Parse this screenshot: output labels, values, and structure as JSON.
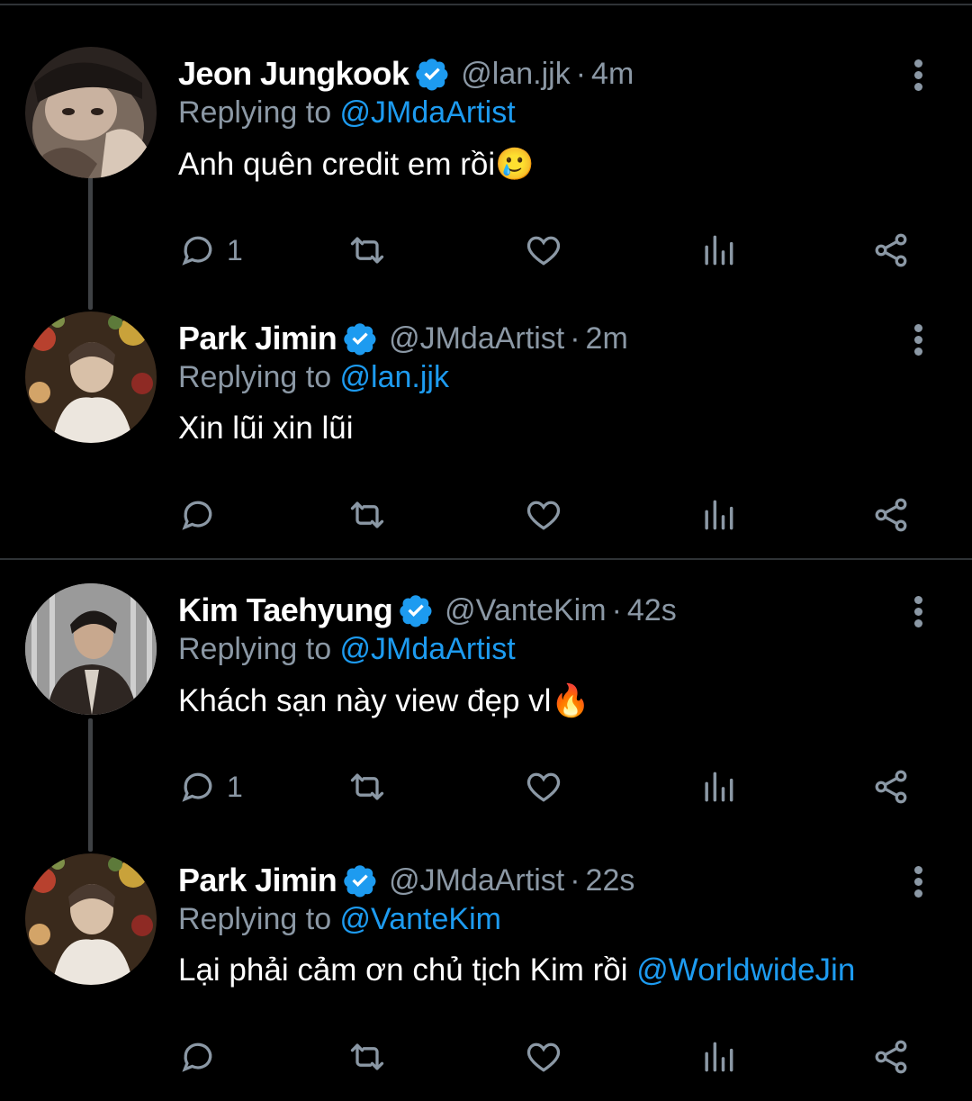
{
  "colors": {
    "background": "#000000",
    "text": "#ffffff",
    "muted": "#8b98a5",
    "accent": "#1d9bf0",
    "divider": "#2f3336"
  },
  "tweets": [
    {
      "name": "Jeon Jungkook",
      "handle": "@lan.jjk",
      "separator": "·",
      "time": "4m",
      "replying_prefix": "Replying to ",
      "replying_to": "@JMdaArtist",
      "text": "Anh quên credit em rồi",
      "emoji": "🥲",
      "reply_count": "1",
      "avatar": "avatar-jungkook"
    },
    {
      "name": "Park Jimin",
      "handle": "@JMdaArtist",
      "separator": "·",
      "time": "2m",
      "replying_prefix": "Replying to ",
      "replying_to": "@lan.jjk",
      "text": "Xin lũi xin lũi",
      "emoji": "",
      "reply_count": "",
      "avatar": "avatar-jimin"
    },
    {
      "name": "Kim Taehyung",
      "handle": "@VanteKim",
      "separator": "·",
      "time": "42s",
      "replying_prefix": "Replying to ",
      "replying_to": "@JMdaArtist",
      "text": "Khách sạn này view đẹp vl",
      "emoji": "🔥",
      "reply_count": "1",
      "avatar": "avatar-taehyung"
    },
    {
      "name": "Park Jimin",
      "handle": "@JMdaArtist",
      "separator": "·",
      "time": "22s",
      "replying_prefix": "Replying to ",
      "replying_to": "@VanteKim",
      "text": "Lại phải cảm ơn chủ tịch Kim rồi ",
      "mention": "@WorldwideJin",
      "reply_count": "",
      "avatar": "avatar-jimin"
    }
  ],
  "icons": {
    "verified": "verified-badge-icon",
    "more": "more-vertical-icon",
    "reply": "reply-bubble-icon",
    "retweet": "retweet-icon",
    "like": "heart-icon",
    "views": "views-bar-icon",
    "share": "share-icon"
  }
}
